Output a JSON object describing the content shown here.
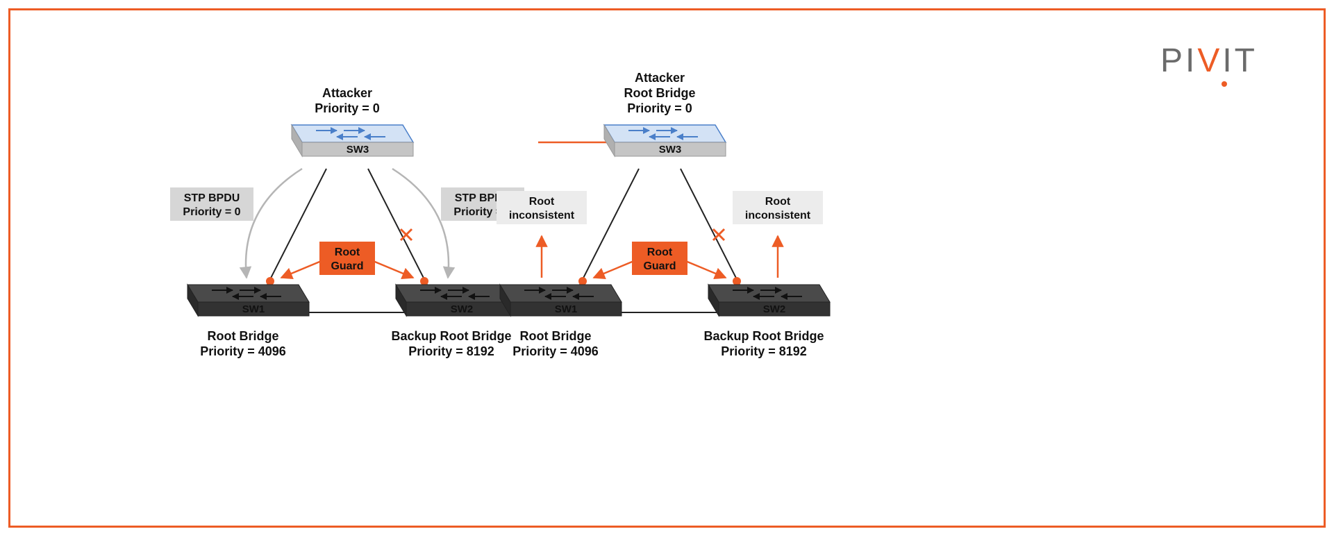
{
  "brand": {
    "logo_text": "PIVIT"
  },
  "colors": {
    "accent": "#ed5c25",
    "gray_light": "#d0d0d0",
    "gray_mid": "#9a9a9a",
    "gray_dark": "#3a3a3a",
    "blue_switch": "#4a7fc9",
    "box_gray": "#e9e9e9"
  },
  "left": {
    "sw3": {
      "name": "SW3",
      "title1": "Attacker",
      "title2": "Priority = 0"
    },
    "sw1": {
      "name": "SW1",
      "title1": "Root Bridge",
      "title2": "Priority = 4096"
    },
    "sw2": {
      "name": "SW2",
      "title1": "Backup Root Bridge",
      "title2": "Priority = 8192"
    },
    "bpdu_left": {
      "line1": "STP BPDU",
      "line2": "Priority = 0"
    },
    "bpdu_right": {
      "line1": "STP BPDU",
      "line2": "Priority = 0"
    },
    "root_guard": {
      "line1": "Root",
      "line2": "Guard"
    }
  },
  "right": {
    "sw3": {
      "name": "SW3",
      "title1": "Attacker",
      "title2": "Root Bridge",
      "title3": "Priority = 0"
    },
    "sw1": {
      "name": "SW1",
      "title1": "Root Bridge",
      "title2": "Priority = 4096"
    },
    "sw2": {
      "name": "SW2",
      "title1": "Backup Root Bridge",
      "title2": "Priority = 8192"
    },
    "inc_left": {
      "line1": "Root",
      "line2": "inconsistent"
    },
    "inc_right": {
      "line1": "Root",
      "line2": "inconsistent"
    },
    "root_guard": {
      "line1": "Root",
      "line2": "Guard"
    }
  }
}
